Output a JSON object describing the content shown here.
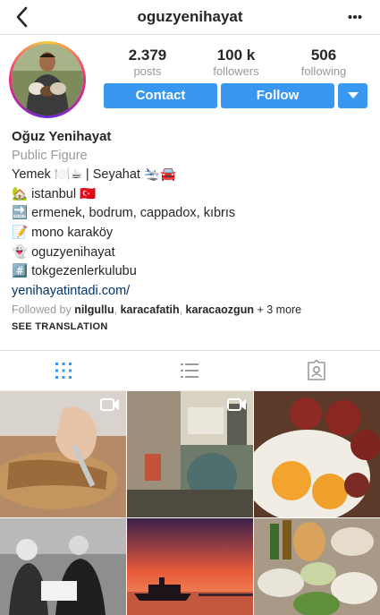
{
  "header": {
    "username": "oguzyenihayat",
    "back_icon": "chevron-left-icon",
    "more_icon": "more-horizontal-icon"
  },
  "stats": [
    {
      "value": "2.379",
      "label": "posts"
    },
    {
      "value": "100 k",
      "label": "followers"
    },
    {
      "value": "506",
      "label": "following"
    }
  ],
  "actions": {
    "contact_label": "Contact",
    "follow_label": "Follow",
    "accent_color": "#3897f0"
  },
  "profile": {
    "name": "Oğuz Yenihayat",
    "category": "Public Figure",
    "bio_lines": [
      "Yemek 🍽️☕ | Seyahat 🛬🚘",
      "🏡 istanbul 🇹🇷",
      "🔜 ermenek, bodrum, cappadox, kıbrıs",
      "📝 mono karaköy",
      "👻 oguzyenihayat",
      "#️⃣ tokgezenlerkulubu"
    ],
    "website": "yenihayatintadi.com/",
    "followed_by": {
      "prefix": "Followed by",
      "users": [
        "nilgullu",
        "karacafatih",
        "karacaozgun"
      ],
      "suffix": "+ 3 more"
    }
  },
  "see_translation": "SEE TRANSLATION",
  "tabs": [
    {
      "name": "grid",
      "icon": "grid-icon",
      "active": true
    },
    {
      "name": "list",
      "icon": "list-icon",
      "active": false
    },
    {
      "name": "tagged",
      "icon": "tagged-icon",
      "active": false
    }
  ],
  "posts": [
    {
      "subject": "hands cutting pastry",
      "video": true
    },
    {
      "subject": "street with graffiti",
      "video": true
    },
    {
      "subject": "fried eggs with sausage",
      "video": false
    },
    {
      "subject": "old black and white photo",
      "video": false
    },
    {
      "subject": "sunset over the sea with ferry",
      "video": false
    },
    {
      "subject": "table with meze dishes",
      "video": false
    }
  ]
}
